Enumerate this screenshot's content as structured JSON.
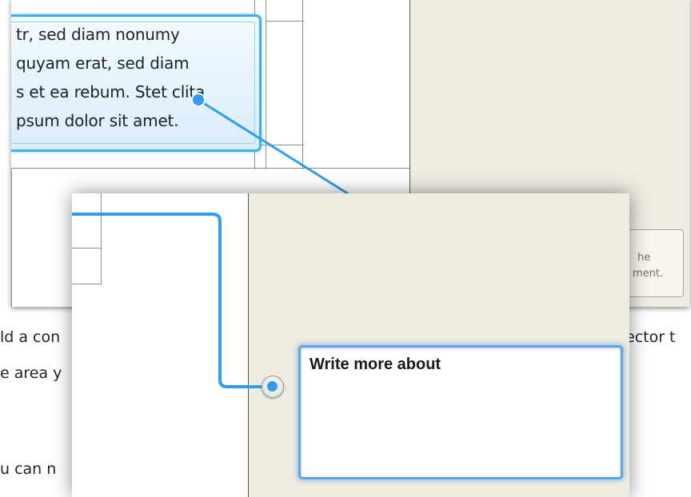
{
  "document": {
    "quote_lines": [
      "tr, sed diam nonumy",
      "quyam erat, sed diam",
      "s et ea rebum. Stet clita",
      "psum dolor sit amet."
    ]
  },
  "sidebar_back": {
    "comment_fragment_lines": [
      "he",
      "ment."
    ]
  },
  "body_text": {
    "line1_left": "ld a con",
    "line1_right": "ector t",
    "line2_left": "e area y",
    "line3_left": "u can n"
  },
  "comment": {
    "text": "Write more about"
  },
  "colors": {
    "accent": "#3ab0f0",
    "connector": "#2f9cf0",
    "sidebar_bg": "#eeece0",
    "comment_border": "#5fa4e6"
  },
  "icons": {
    "anchor": "comment-anchor-icon",
    "endpoint": "connector-endpoint-icon"
  }
}
